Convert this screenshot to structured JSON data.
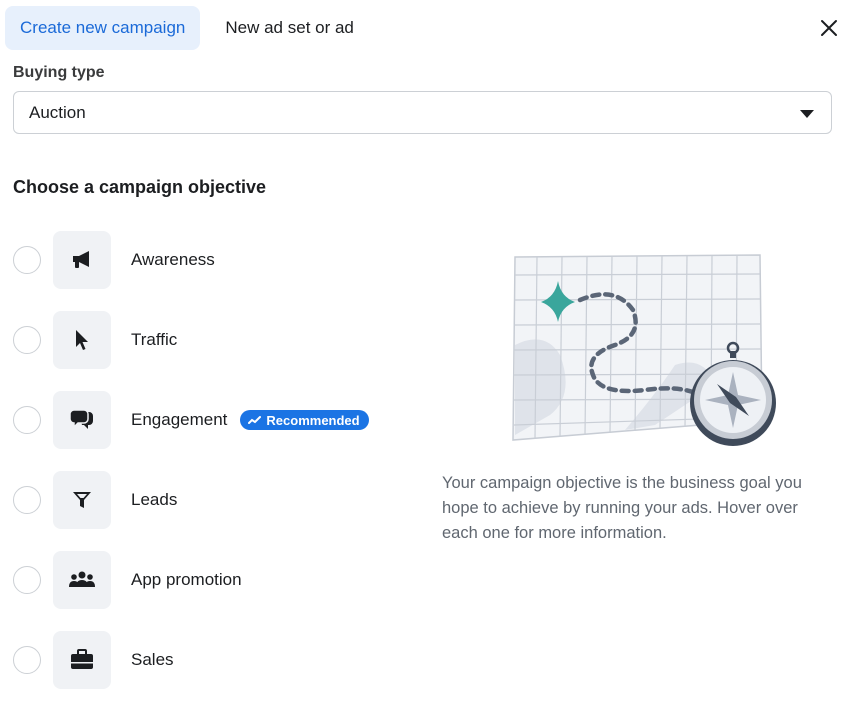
{
  "tabs": [
    {
      "label": "Create new campaign",
      "active": true
    },
    {
      "label": "New ad set or ad",
      "active": false
    }
  ],
  "buying_type": {
    "label": "Buying type",
    "value": "Auction"
  },
  "objective_section": {
    "title": "Choose a campaign objective",
    "objectives": [
      {
        "label": "Awareness",
        "icon": "megaphone-icon"
      },
      {
        "label": "Traffic",
        "icon": "cursor-icon"
      },
      {
        "label": "Engagement",
        "icon": "chat-bubbles-icon",
        "badge": "Recommended"
      },
      {
        "label": "Leads",
        "icon": "funnel-icon"
      },
      {
        "label": "App promotion",
        "icon": "people-icon"
      },
      {
        "label": "Sales",
        "icon": "briefcase-icon"
      }
    ]
  },
  "description": "Your campaign objective is the business goal you hope to achieve by running your ads. Hover over each one for more information.",
  "colors": {
    "accent": "#1b74e4",
    "active_tab_bg": "#e7f0fc",
    "illustration_teal": "#3aa69c"
  }
}
